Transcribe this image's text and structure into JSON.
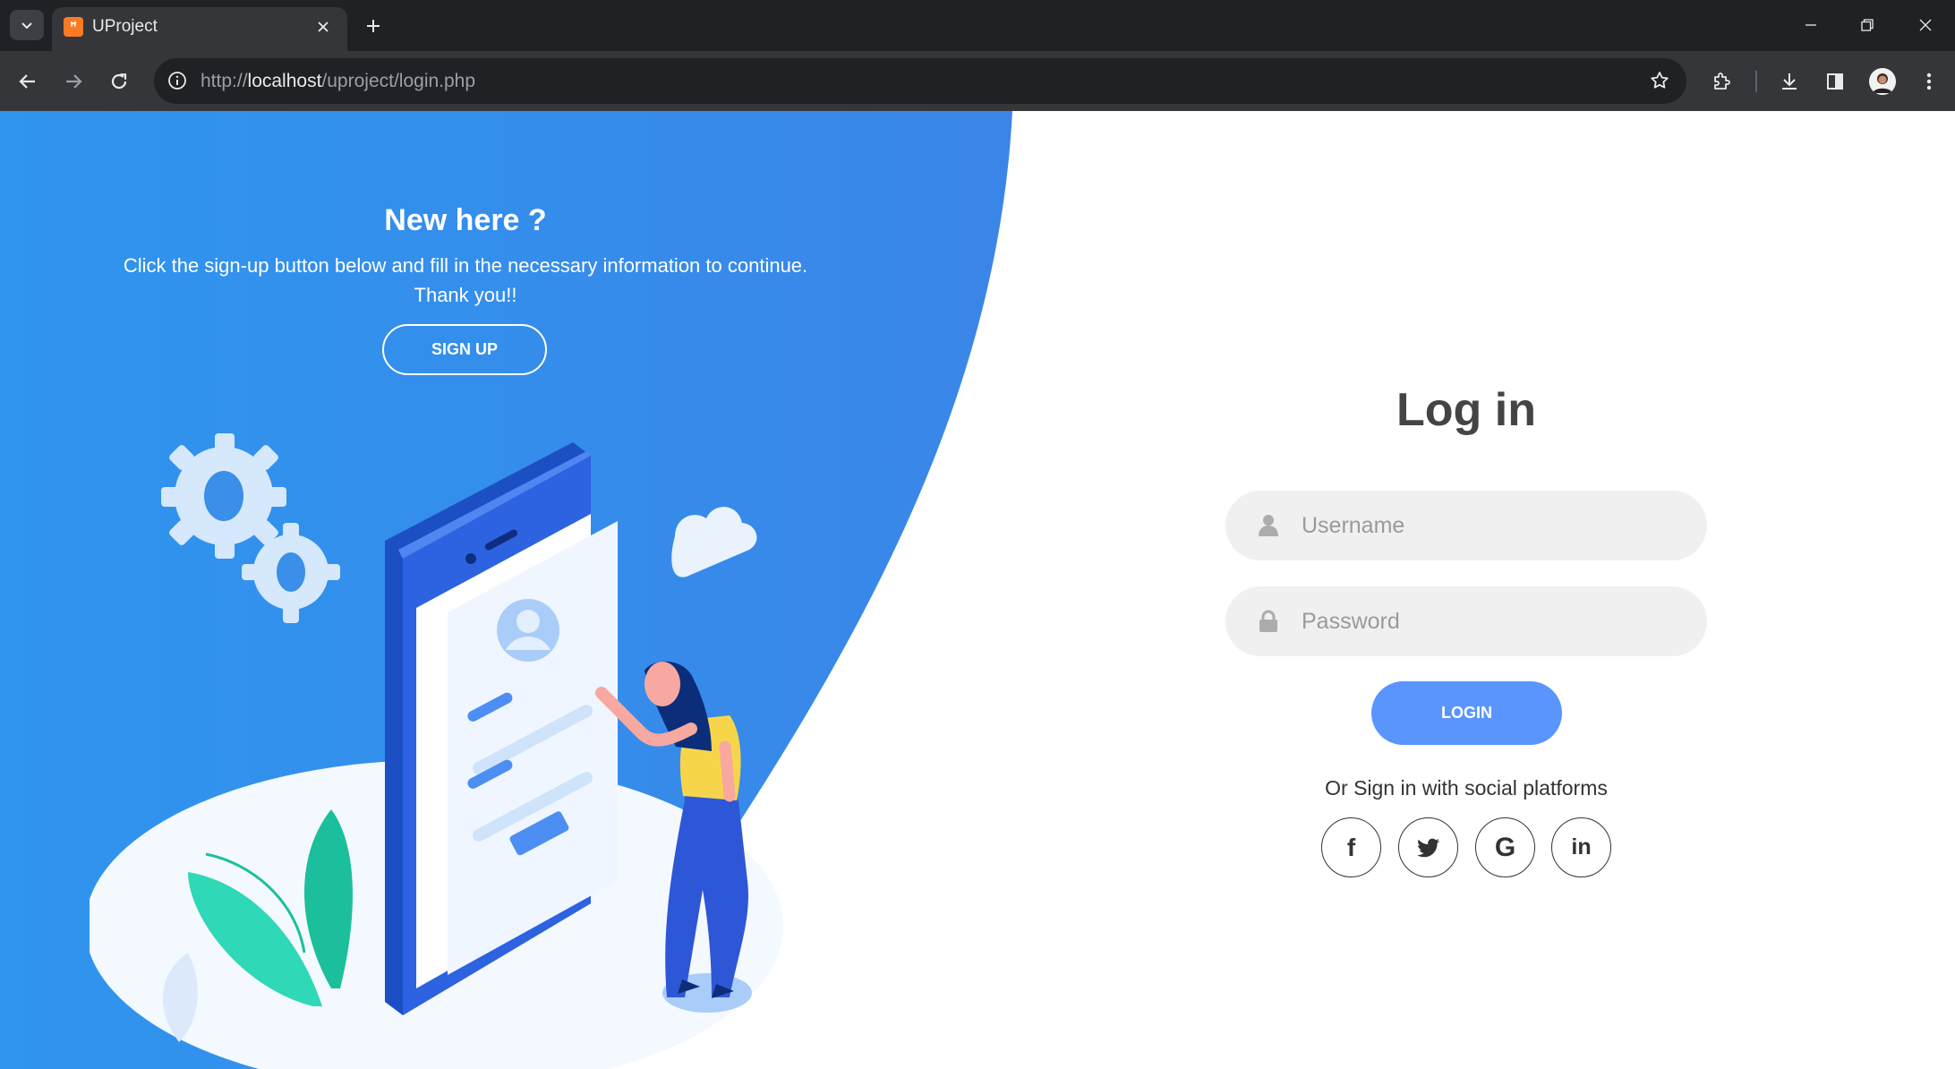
{
  "browser": {
    "tab_title": "UProject",
    "tab_favicon": "xampp-icon",
    "url_prefix": "http://",
    "url_host": "localhost",
    "url_path": "/uproject/login.php"
  },
  "signup_panel": {
    "title": "New here ?",
    "text": "Click the sign-up button below and fill in the necessary information to continue. Thank you!!",
    "button_label": "SIGN UP"
  },
  "login_form": {
    "title": "Log in",
    "username_placeholder": "Username",
    "password_placeholder": "Password",
    "login_label": "LOGIN",
    "social_text": "Or Sign in with social platforms",
    "social": [
      {
        "name": "facebook",
        "glyph": "f"
      },
      {
        "name": "twitter",
        "glyph": "twitter-bird"
      },
      {
        "name": "google",
        "glyph": "G"
      },
      {
        "name": "linkedin",
        "glyph": "in"
      }
    ]
  },
  "colors": {
    "accent_blue": "#4481eb",
    "login_button": "#5995fd",
    "field_bg": "#f0f0f0",
    "chrome_dark": "#202124",
    "chrome_toolbar": "#35363a"
  }
}
